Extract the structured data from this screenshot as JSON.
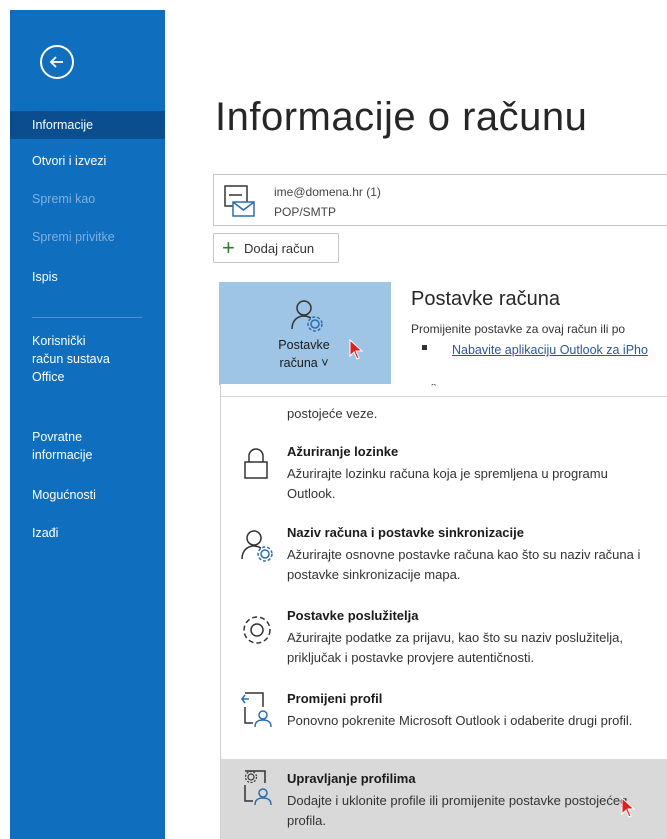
{
  "sidebar": {
    "items": [
      {
        "label": "Informacije",
        "state": "active"
      },
      {
        "label": "Otvori i izvezi",
        "state": "normal"
      },
      {
        "label": "Spremi kao",
        "state": "disabled"
      },
      {
        "label": "Spremi privitke",
        "state": "disabled"
      },
      {
        "label": "Ispis",
        "state": "normal"
      },
      {
        "label": "Korisnički račun sustava Office",
        "state": "normal"
      },
      {
        "label": "Povratne informacije",
        "state": "normal"
      },
      {
        "label": "Mogućnosti",
        "state": "normal"
      },
      {
        "label": "Izađi",
        "state": "normal"
      }
    ]
  },
  "main": {
    "title": "Informacije o računu",
    "account": {
      "email": "ime@domena.hr (1)",
      "type": "POP/SMTP"
    },
    "add_account_label": "Dodaj račun",
    "settings_tile": {
      "line1": "Postavke",
      "line2": "računa ˅"
    },
    "section": {
      "heading": "Postavke računa",
      "description": "Promijenite postavke za ovaj račun ili po",
      "link": "Nabavite aplikaciju Outlook za iPho"
    }
  },
  "dropdown": {
    "cut_text": "postojeće veze.",
    "items": [
      {
        "title": "Ažuriranje lozinke",
        "desc": "Ažurirajte lozinku računa koja je spremljena u programu Outlook.",
        "icon": "lock-icon"
      },
      {
        "title": "Naziv računa i postavke sinkronizacije",
        "desc": "Ažurirajte osnovne postavke računa kao što su naziv računa i postavke sinkronizacije mapa.",
        "icon": "user-gear-icon"
      },
      {
        "title": "Postavke poslužitelja",
        "desc": "Ažurirajte podatke za prijavu, kao što su naziv poslužitelja, priključak i postavke provjere autentičnosti.",
        "icon": "gear-icon"
      },
      {
        "title": "Promijeni profil",
        "desc": "Ponovno pokrenite Microsoft Outlook i odaberite drugi profil.",
        "icon": "switch-profile-icon"
      },
      {
        "title": "Upravljanje profilima",
        "desc": "Dodajte i uklonite profile ili promijenite postavke postojećeg profila.",
        "icon": "manage-profiles-icon"
      }
    ]
  },
  "colors": {
    "sidebar": "#106ebe",
    "sidebar_active": "#0a4e8f",
    "tile": "#9ec5e6",
    "cursor": "#e02020",
    "hover": "#d9d9d9"
  }
}
